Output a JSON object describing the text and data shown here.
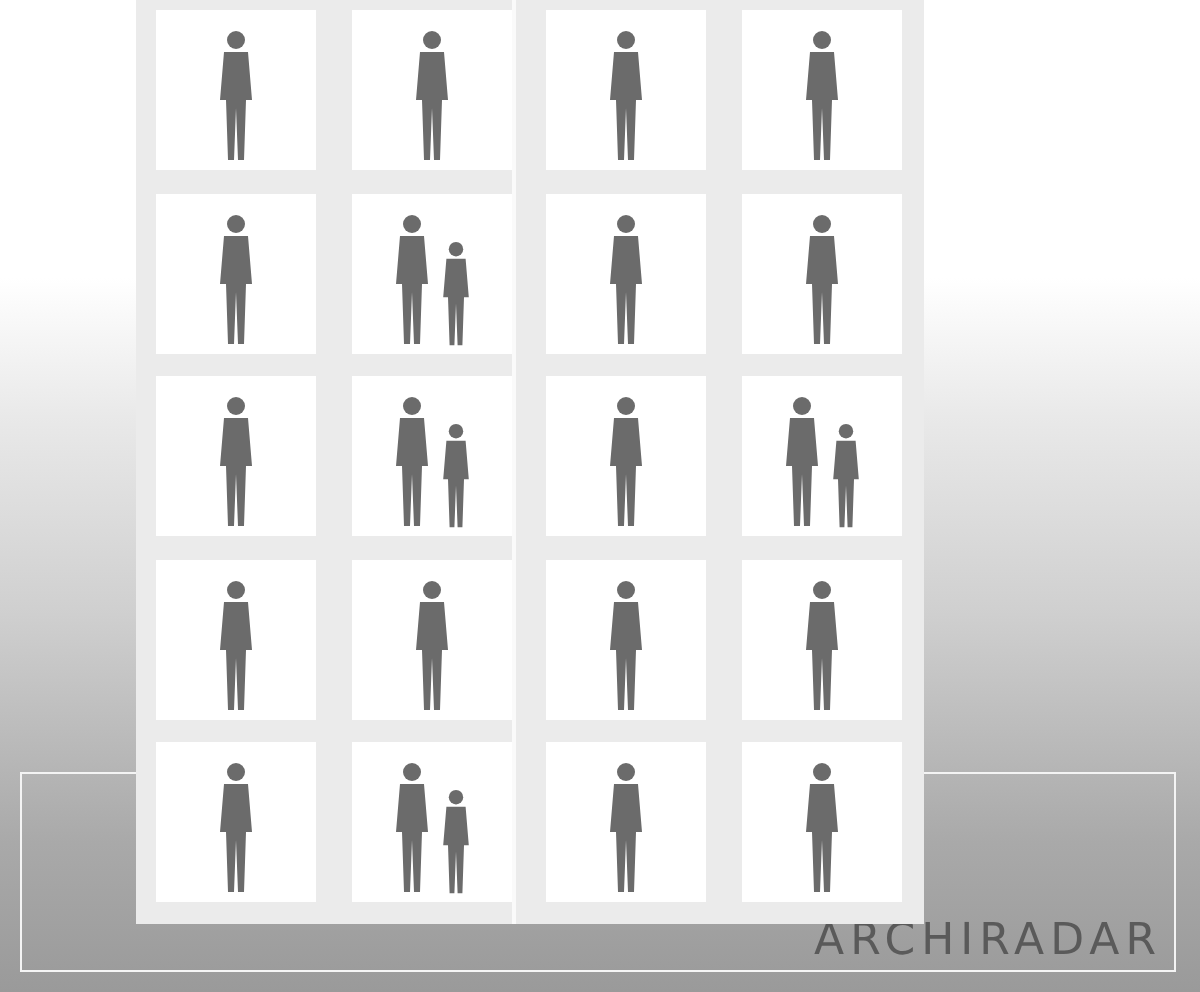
{
  "photos": [
    {
      "kind": "single"
    },
    {
      "kind": "single"
    },
    {
      "kind": "single"
    },
    {
      "kind": "single"
    },
    {
      "kind": "single"
    },
    {
      "kind": "group"
    },
    {
      "kind": "single"
    },
    {
      "kind": "single"
    },
    {
      "kind": "single"
    },
    {
      "kind": "group"
    },
    {
      "kind": "single"
    },
    {
      "kind": "group"
    },
    {
      "kind": "single"
    },
    {
      "kind": "single"
    },
    {
      "kind": "single"
    },
    {
      "kind": "single"
    },
    {
      "kind": "single"
    },
    {
      "kind": "group"
    },
    {
      "kind": "single"
    },
    {
      "kind": "single"
    }
  ],
  "logo": {
    "text": "ARCHIRADAR"
  }
}
